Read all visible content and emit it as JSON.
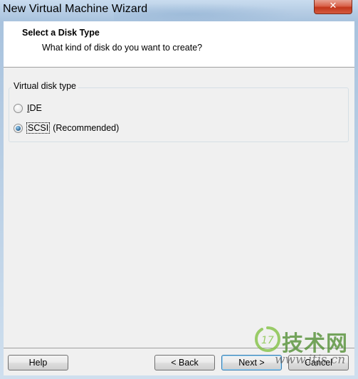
{
  "window": {
    "title": "New Virtual Machine Wizard",
    "close_glyph": "✕"
  },
  "header": {
    "title": "Select a Disk Type",
    "subtitle": "What kind of disk do you want to create?"
  },
  "group": {
    "label": "Virtual disk type",
    "options": [
      {
        "label": "IDE",
        "checked": false
      },
      {
        "label": "SCSI",
        "suffix": "(Recommended)",
        "checked": true
      }
    ]
  },
  "buttons": {
    "help": "Help",
    "back": "< Back",
    "next": "Next >",
    "cancel": "Cancel"
  },
  "watermark": {
    "logo_text": "17",
    "big": "技术网",
    "small": "www.itjs.cn"
  }
}
